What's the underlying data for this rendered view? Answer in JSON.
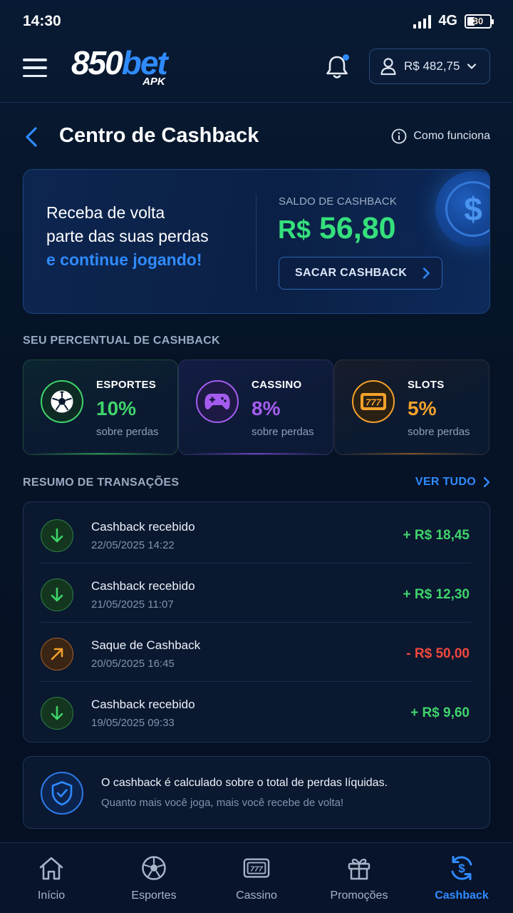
{
  "status_bar": {
    "time": "14:30",
    "network": "4G",
    "battery": "30"
  },
  "header": {
    "logo_number": "850",
    "logo_word": "bet",
    "logo_sub": "APK",
    "balance": "R$ 482,75"
  },
  "page": {
    "title": "Centro de Cashback",
    "how_it_works": "Como funciona"
  },
  "hero": {
    "line1": "Receba de volta",
    "line2": "parte das suas perdas",
    "line3": "e continue jogando!",
    "balance_label": "SALDO DE CASHBACK",
    "currency": "R$",
    "amount": "56,80",
    "withdraw_label": "SACAR CASHBACK"
  },
  "percent_section": {
    "label": "SEU PERCENTUAL DE CASHBACK",
    "cards": [
      {
        "name": "ESPORTES",
        "value": "10%",
        "sub": "sobre perdas",
        "color": "#3fd46b",
        "icon": "soccer-ball-icon"
      },
      {
        "name": "CASSINO",
        "value": "8%",
        "sub": "sobre perdas",
        "color": "#a45cf0",
        "icon": "gamepad-icon"
      },
      {
        "name": "SLOTS",
        "value": "5%",
        "sub": "sobre perdas",
        "color": "#f4a12b",
        "icon": "slot-777-icon"
      }
    ]
  },
  "transactions": {
    "label": "RESUMO DE TRANSAÇÕES",
    "see_all": "VER TUDO",
    "items": [
      {
        "title": "Cashback recebido",
        "date": "22/05/2025 14:22",
        "amount": "+ R$ 18,45",
        "type": "in"
      },
      {
        "title": "Cashback recebido",
        "date": "21/05/2025 11:07",
        "amount": "+ R$ 12,30",
        "type": "in"
      },
      {
        "title": "Saque de Cashback",
        "date": "20/05/2025 16:45",
        "amount": "- R$ 50,00",
        "type": "out"
      },
      {
        "title": "Cashback recebido",
        "date": "19/05/2025 09:33",
        "amount": "+ R$ 9,60",
        "type": "in"
      }
    ]
  },
  "info": {
    "title": "O cashback é calculado sobre o total de perdas líquidas.",
    "subtitle": "Quanto mais você joga, mais você recebe de volta!"
  },
  "nav": {
    "items": [
      {
        "label": "Início",
        "icon": "home-icon"
      },
      {
        "label": "Esportes",
        "icon": "soccer-ball-icon"
      },
      {
        "label": "Cassino",
        "icon": "slot-machine-icon"
      },
      {
        "label": "Promoções",
        "icon": "gift-icon"
      },
      {
        "label": "Cashback",
        "icon": "cashback-icon",
        "active": true
      }
    ]
  },
  "colors": {
    "accent": "#2f8bff",
    "positive": "#3fd46b",
    "negative": "#f0483c",
    "background": "#071428"
  }
}
